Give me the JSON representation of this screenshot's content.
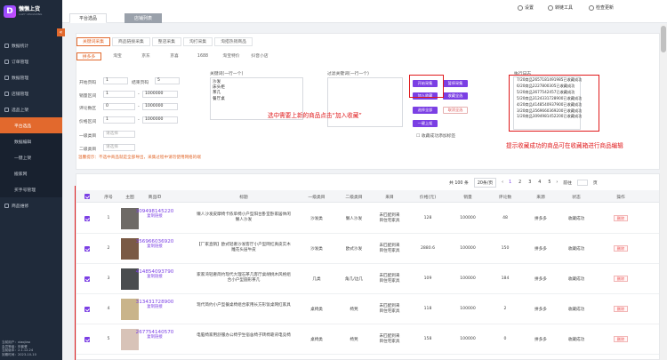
{
  "app": {
    "logo": "D",
    "name": "懒懒上货",
    "sub": "LAZY UPLOADING"
  },
  "sidebar": {
    "items": [
      {
        "label": "数据统计",
        "icon": "chart-icon"
      },
      {
        "label": "订单管理",
        "icon": "order-icon"
      },
      {
        "label": "数据管理",
        "icon": "data-icon"
      },
      {
        "label": "店铺管理",
        "icon": "shop-icon"
      },
      {
        "label": "选品上架",
        "icon": "product-icon"
      },
      {
        "label": "平台选品",
        "active": true,
        "sub": true
      },
      {
        "label": "数据编辑",
        "sub": true
      },
      {
        "label": "一键上架",
        "sub": true
      },
      {
        "label": "搬家网",
        "sub": true
      },
      {
        "label": "买手号管理",
        "sub": true
      },
      {
        "label": "商品维修",
        "icon": "repair-icon"
      }
    ],
    "info": [
      "当前用户：xiaojiao",
      "会员等级：年套餐",
      "当前版本：2.1.12.24",
      "到期时间：2023-10-10"
    ]
  },
  "tabs": {
    "platform": "平台选品",
    "other": "店铺列表"
  },
  "topright": {
    "settings": "设置",
    "tools": "转链工具",
    "update": "检查更新"
  },
  "collect_tabs": [
    "关键词采集",
    "商品链接采集",
    "整店采集",
    "淘打采集",
    "淘搭热销商品"
  ],
  "platforms": [
    "拼多多",
    "淘宝",
    "京东",
    "京喜",
    "1688",
    "淘宝特价",
    "抖音小店"
  ],
  "filters": {
    "start_page": "开始页码",
    "end_page": "结束页码",
    "start_val": "1",
    "end_val": "5",
    "sales": "销量区间",
    "sales_from": "1",
    "sales_to": "1000000",
    "comments": "评论数区",
    "comments_from": "0",
    "comments_to": "1000000",
    "price": "价格区间",
    "price_from": "1",
    "price_to": "1000000",
    "cat1": "一级类目",
    "cat1_ph": "请选择",
    "cat2": "二级类目",
    "cat2_ph": "请选择"
  },
  "keyword_label": "关键词(一行一个)",
  "keywords": [
    "沙发",
    "床头柜",
    "茶几",
    "餐厅桌"
  ],
  "filter_label": "过滤关键词(一行一个)",
  "actions": {
    "start": "开始采集",
    "stop": "暂停采集",
    "fav": "加入收藏",
    "collected": "收藏全选",
    "select_all": "选择全部",
    "cancel_sel": "取消全选",
    "one_click": "一键上架",
    "auto_tag": "收藏成功添加标签"
  },
  "log": {
    "label": "执行日志",
    "lines": [
      "7/20商品2657181491985已收藏成功",
      "6/20商品2227800305已收藏成功",
      "5/20商品3677542457已收藏成功",
      "5/20商品3124331728900已收藏成功",
      "4/20商品4148540937900已收藏成功",
      "3/20商品3569660369200已收藏成功",
      "1/20商品3094981452200已收藏成功"
    ]
  },
  "tip": "温馨提示：不选中商品就是全部导出，采集过程中请勿使用网络的端",
  "annotations": {
    "a1": "选中需要上新的商品点击“加入收藏”",
    "a2": "提示收藏成功的商品可在收藏箱进行商品编辑"
  },
  "pagination": {
    "total": "共 100 条",
    "per": "20条/页",
    "pages": [
      "1",
      "2",
      "3",
      "4",
      "5"
    ],
    "goto": "前往",
    "page": "页"
  },
  "columns": [
    "序号",
    "主图",
    "商品ID",
    "标题",
    "一级类目",
    "二级类目",
    "来目",
    "价格(元)",
    "销量",
    "评论数",
    "来源",
    "状态",
    "操作"
  ],
  "rows": [
    {
      "n": "1",
      "id": "309498145220",
      "title": "懒人沙发皮摩椅卡侬单椅小户型阳台卧室卧家居休闲懒人沙发",
      "c1": "沙发类",
      "c2": "懒人沙发",
      "src": "未匹配到来目住宅家具",
      "price": "128",
      "sales": "100000",
      "cmt": "48",
      "from": "拼多多",
      "state": "收藏成功",
      "color": "#6e6a66"
    },
    {
      "n": "2",
      "id": "356966036920",
      "title": "【厂家直销】欧式轻奢沙发客厅小户型网红真皮实木雕花头层牛皮",
      "c1": "沙发类",
      "c2": "欧式沙发",
      "src": "未匹配到来目住宅家具",
      "price": "2880.6",
      "sales": "100000",
      "cmt": "150",
      "from": "拼多多",
      "state": "收藏成功",
      "color": "#7a5a45"
    },
    {
      "n": "3",
      "id": "414854093790",
      "title": "家家湾轻奢简约现代大理石茶几客厅桌胡桃木风格组合小户型圆形茶几",
      "c1": "几类",
      "c2": "角几/边几",
      "src": "未匹配到来目住宅家具",
      "price": "109",
      "sales": "100000",
      "cmt": "184",
      "from": "拼多多",
      "state": "收藏成功",
      "color": "#4a4d4f"
    },
    {
      "n": "4",
      "id": "313431728900",
      "title": "现代简约小户型餐桌椅组合家用长方形饭桌网红家具",
      "c1": "桌椅类",
      "c2": "椅凳",
      "src": "未匹配到来目住宅家具",
      "price": "118",
      "sales": "100000",
      "cmt": "2",
      "from": "拼多多",
      "state": "收藏成功",
      "color": "#c9b48a"
    },
    {
      "n": "5",
      "id": "267754140570",
      "title": "电脑椅家用舒服办公椅学生宿舍椅子转椅靠背电竞椅",
      "c1": "桌椅类",
      "c2": "椅凳",
      "src": "未匹配到来目住宅家具",
      "price": "158",
      "sales": "100000",
      "cmt": "0",
      "from": "拼多多",
      "state": "收藏成功",
      "color": "#d8c3b8"
    }
  ],
  "copy_label": "复制链接",
  "del_label": "删除"
}
